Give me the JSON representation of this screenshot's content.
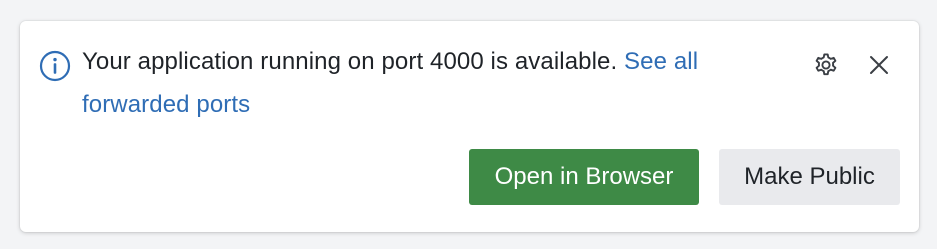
{
  "notification": {
    "message": "Your application running on port 4000 is available.",
    "link_text": "See all forwarded ports",
    "primary_button": "Open in Browser",
    "secondary_button": "Make Public"
  },
  "icons": {
    "info": "info-circle-icon",
    "settings": "gear-icon",
    "close": "close-icon"
  },
  "colors": {
    "info_icon": "#2f6db5",
    "link": "#2f6db5",
    "primary_button_bg": "#3e8a46",
    "secondary_button_bg": "#e9eaed",
    "text": "#1f2328"
  }
}
